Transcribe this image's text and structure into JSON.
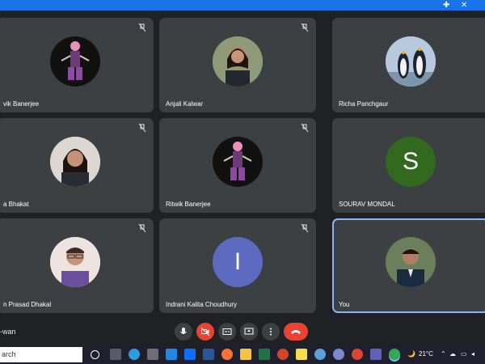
{
  "meeting": {
    "code_fragment": "-wan",
    "participants": [
      {
        "name": "vik Banerjee",
        "avatar": "anime-figure",
        "muted": true
      },
      {
        "name": "Anjali Kalwar",
        "avatar": "photo-woman",
        "muted": true
      },
      {
        "name": "Richa Panchgaur",
        "avatar": "penguins",
        "muted": false
      },
      {
        "name": "a Bhakat",
        "avatar": "photo-woman-2",
        "muted": true
      },
      {
        "name": "Ritwik Banerjee",
        "avatar": "anime-figure",
        "muted": true
      },
      {
        "name": "SOURAV MONDAL",
        "avatar": "letter",
        "letter": "S",
        "color": "#33691e",
        "muted": false
      },
      {
        "name": "n Prasad Dhakal",
        "avatar": "photo-man",
        "muted": true
      },
      {
        "name": "Indrani Kalita Choudhury",
        "avatar": "letter",
        "letter": "I",
        "color": "#5c6bc0",
        "muted": true
      },
      {
        "name": "You",
        "avatar": "photo-you",
        "muted": false,
        "active": true
      }
    ]
  },
  "taskbar": {
    "search_placeholder": "arch",
    "weather": "21°C"
  },
  "colors": {
    "accent": "#1a73e8",
    "tile": "#3c4043",
    "danger": "#ea4335"
  }
}
